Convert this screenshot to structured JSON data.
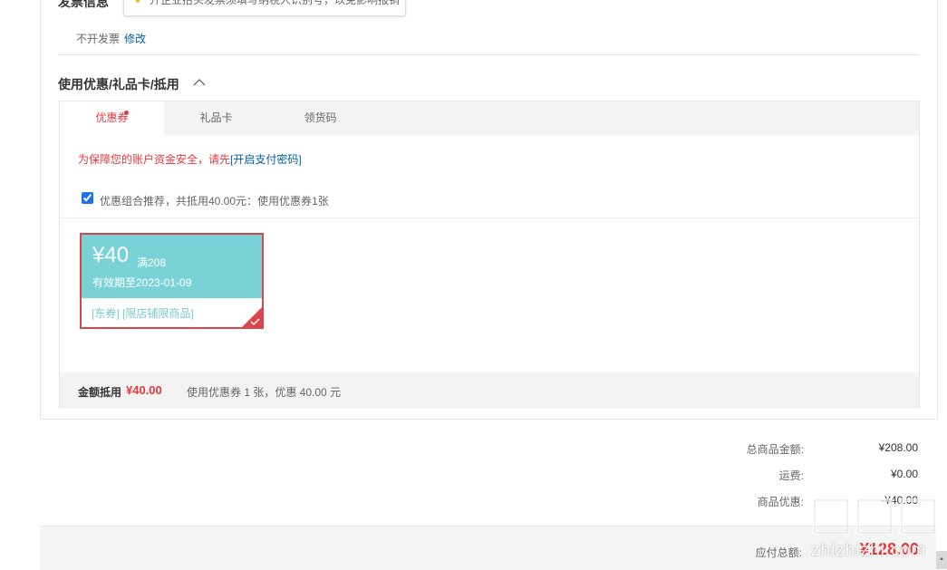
{
  "invoice": {
    "title": "发票信息",
    "tooltip": "开企业抬头发票须填写纳税人识别号，以免影响报销",
    "status": "不开发票",
    "edit_label": "修改"
  },
  "coupon_section": {
    "title": "使用优惠/礼品卡/抵用",
    "tabs": [
      {
        "label": "优惠券"
      },
      {
        "label": "礼品卡"
      },
      {
        "label": "领货码"
      }
    ],
    "security_tip": "为保障您的账户资金安全，请先",
    "security_link": "[开启支付密码]",
    "combo_text": "优惠组合推荐，共抵用40.00元：使用优惠券1张",
    "coupon": {
      "amount": "¥40",
      "condition": "满208",
      "expiry": "有效期至2023-01-09",
      "tags": "[东券] [限店铺限商品]"
    },
    "summary": {
      "label": "金额抵用",
      "amount": "¥40.00",
      "desc": "使用优惠券 1 张，优惠 40.00 元"
    }
  },
  "totals": {
    "goods_label": "总商品金额:",
    "goods_value": "¥208.00",
    "shipping_label": "运费:",
    "shipping_value": "¥0.00",
    "discount_label": "商品优惠:",
    "discount_value": "-¥40.00"
  },
  "payable": {
    "label": "应付总额:",
    "value": "¥128.00"
  },
  "watermark": {
    "text": "zhizhizhi.com"
  },
  "colors": {
    "accent_red": "#e4393c",
    "link_blue": "#005ea7",
    "coupon_teal": "#79d3d6"
  }
}
